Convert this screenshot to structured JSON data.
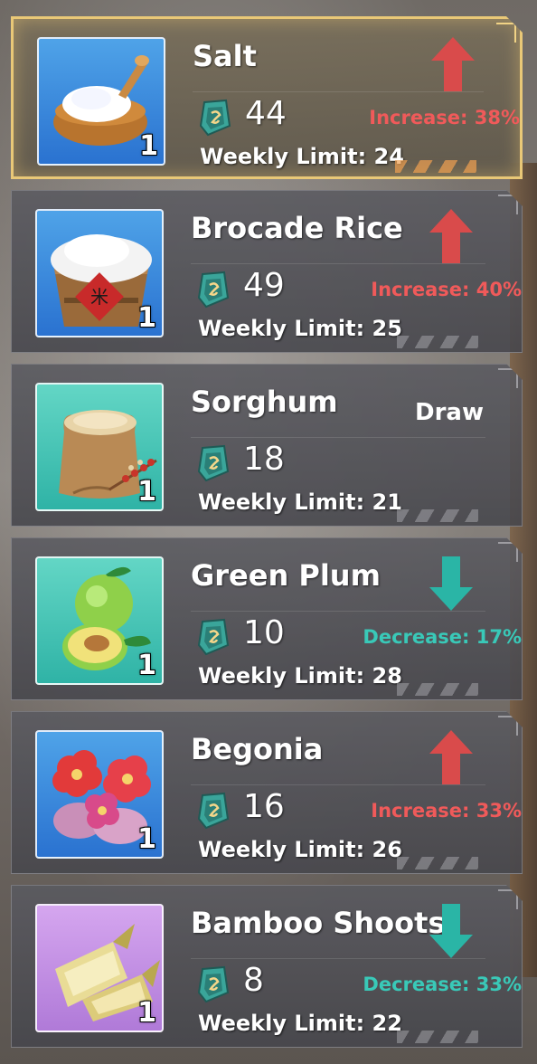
{
  "items": [
    {
      "name": "Salt",
      "price": "44",
      "limit": "Weekly Limit: 24",
      "qty": "1",
      "trend": "up",
      "trend_text": "Increase: 38%",
      "icon": "salt-bowl-icon",
      "selected": true
    },
    {
      "name": "Brocade Rice",
      "price": "49",
      "limit": "Weekly Limit: 25",
      "qty": "1",
      "trend": "up",
      "trend_text": "Increase: 40%",
      "icon": "rice-bucket-icon",
      "selected": false
    },
    {
      "name": "Sorghum",
      "price": "18",
      "limit": "Weekly Limit: 21",
      "qty": "1",
      "trend": "draw",
      "trend_text": "Draw",
      "icon": "sorghum-sack-icon",
      "selected": false
    },
    {
      "name": "Green Plum",
      "price": "10",
      "limit": "Weekly Limit: 28",
      "qty": "1",
      "trend": "down",
      "trend_text": "Decrease: 17%",
      "icon": "green-plum-icon",
      "selected": false
    },
    {
      "name": "Begonia",
      "price": "16",
      "limit": "Weekly Limit: 26",
      "qty": "1",
      "trend": "up",
      "trend_text": "Increase: 33%",
      "icon": "begonia-flower-icon",
      "selected": false
    },
    {
      "name": "Bamboo Shoots",
      "price": "8",
      "limit": "Weekly Limit: 22",
      "qty": "1",
      "trend": "down",
      "trend_text": "Decrease: 33%",
      "icon": "bamboo-shoots-icon",
      "selected": false
    }
  ],
  "colors": {
    "increase": "#f05a5a",
    "decrease": "#39c9b8",
    "selected_border": "#e9c877"
  },
  "currency_icon": "ticket-coin-icon"
}
